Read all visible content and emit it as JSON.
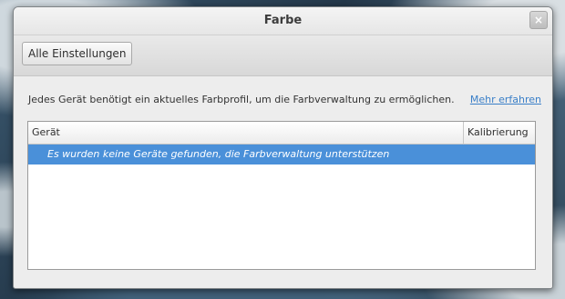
{
  "window": {
    "title": "Farbe",
    "close_label": "×"
  },
  "toolbar": {
    "all_settings_label": "Alle Einstellungen"
  },
  "info": {
    "text": "Jedes Gerät benötigt ein aktuelles Farbprofil, um die Farbverwaltung zu ermöglichen.",
    "learn_more": "Mehr erfahren"
  },
  "table": {
    "columns": [
      "Gerät",
      "Kalibrierung"
    ],
    "empty_message": "Es wurden keine Geräte gefunden, die Farbverwaltung unterstützen"
  },
  "colors": {
    "selection": "#4a90d9",
    "link": "#3a7fc8"
  },
  "icons": {
    "close": "close-icon"
  }
}
